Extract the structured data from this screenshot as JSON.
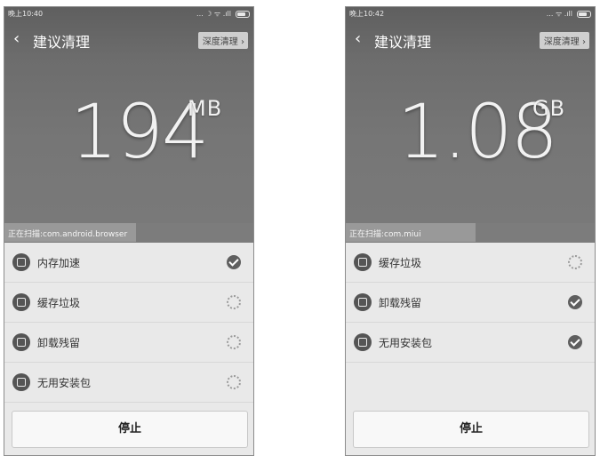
{
  "left": {
    "status_time": "晚上10:40",
    "status_icons": "... ☽ ᯤ .ıll",
    "title": "建议清理",
    "deep_clean": "深度清理 ›",
    "size_value": "194",
    "size_unit": "MB",
    "scan_text": "正在扫描:com.android.browser",
    "scan_progress": 0.53,
    "tasks": [
      {
        "label": "内存加速",
        "icon": "speedometer-icon",
        "status": "done"
      },
      {
        "label": "缓存垃圾",
        "icon": "download-box-icon",
        "status": "pending"
      },
      {
        "label": "卸载残留",
        "icon": "document-icon",
        "status": "pending"
      },
      {
        "label": "无用安装包",
        "icon": "folder-icon",
        "status": "pending"
      }
    ],
    "stop": "停止"
  },
  "right": {
    "status_time": "晚上10:42",
    "status_icons": "... ᯤ .ıll",
    "title": "建议清理",
    "deep_clean": "深度清理 ›",
    "size_value": "1.08",
    "size_unit": "GB",
    "scan_text": "正在扫描:com.miui",
    "scan_progress": 0.52,
    "tasks": [
      {
        "label": "缓存垃圾",
        "icon": "download-box-icon",
        "status": "pending"
      },
      {
        "label": "卸载残留",
        "icon": "document-icon",
        "status": "done"
      },
      {
        "label": "无用安装包",
        "icon": "folder-icon",
        "status": "done"
      }
    ],
    "stop": "停止"
  }
}
